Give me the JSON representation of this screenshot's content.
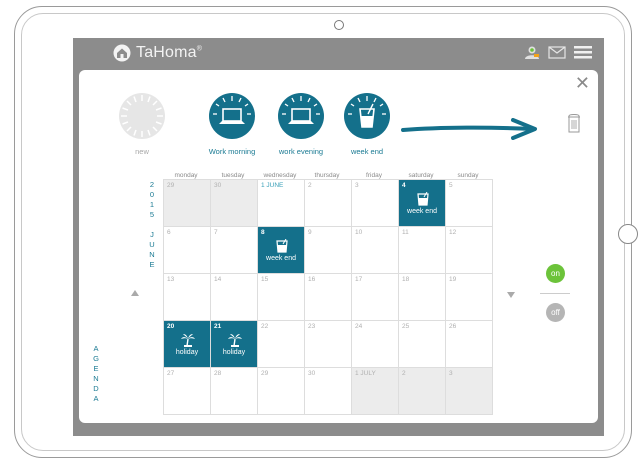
{
  "app": {
    "brand": "TaHoma",
    "brand_mark": "®"
  },
  "modal": {
    "close_symbol": "✕"
  },
  "programs": [
    {
      "label": "new"
    },
    {
      "label": "Work morning"
    },
    {
      "label": "work evening"
    },
    {
      "label": "week end"
    }
  ],
  "calendar": {
    "year": [
      "2",
      "0",
      "1",
      "5"
    ],
    "month": [
      "J",
      "U",
      "N",
      "E"
    ],
    "agenda": [
      "A",
      "G",
      "E",
      "N",
      "D",
      "A"
    ],
    "day_headers": [
      "monday",
      "tuesday",
      "wednesday",
      "thursday",
      "friday",
      "saturday",
      "sunday"
    ],
    "rows": [
      [
        {
          "n": "29",
          "off": true
        },
        {
          "n": "30",
          "off": true
        },
        {
          "n": "1 JUNE",
          "first": true
        },
        {
          "n": "2"
        },
        {
          "n": "3"
        },
        {
          "n": "4",
          "prog": "week end"
        },
        {
          "n": "5"
        }
      ],
      [
        {
          "n": "6"
        },
        {
          "n": "7"
        },
        {
          "n": "8",
          "prog": "week end"
        },
        {
          "n": "9"
        },
        {
          "n": "10"
        },
        {
          "n": "11"
        },
        {
          "n": "12"
        }
      ],
      [
        {
          "n": "13"
        },
        {
          "n": "14"
        },
        {
          "n": "15"
        },
        {
          "n": "16"
        },
        {
          "n": "17"
        },
        {
          "n": "18"
        },
        {
          "n": "19"
        }
      ],
      [
        {
          "n": "20",
          "prog": "holiday"
        },
        {
          "n": "21",
          "prog": "holiday"
        },
        {
          "n": "22"
        },
        {
          "n": "23"
        },
        {
          "n": "24"
        },
        {
          "n": "25"
        },
        {
          "n": "26"
        }
      ],
      [
        {
          "n": "27"
        },
        {
          "n": "28"
        },
        {
          "n": "29"
        },
        {
          "n": "30"
        },
        {
          "n": "1 JULY",
          "off": true
        },
        {
          "n": "2",
          "off": true
        },
        {
          "n": "3",
          "off": true
        }
      ]
    ]
  },
  "toggles": {
    "on_label": "on",
    "off_label": "off"
  },
  "colors": {
    "accent": "#14708b",
    "on": "#6cc33a",
    "off": "#b5b5b5",
    "frame": "#8c8c8c"
  },
  "icons": {
    "week_end": "drink-icon",
    "holiday": "palm-tree-icon",
    "work_morning": "laptop-icon",
    "work_evening": "laptop-icon"
  }
}
